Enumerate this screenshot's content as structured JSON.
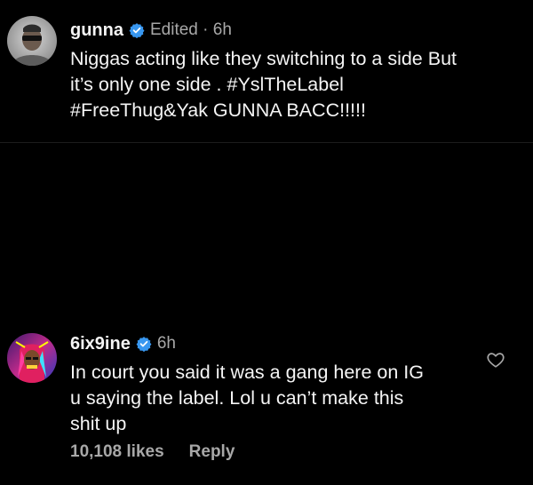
{
  "post": {
    "username": "gunna",
    "meta": "Edited · 6h",
    "lines": [
      "Niggas acting like they switching to a side But",
      "it’s only one side . #YslTheLabel",
      "#FreeThug&Yak  GUNNA BACC!!!!!"
    ],
    "avatar_icon": "avatar-icon"
  },
  "comment": {
    "username": "6ix9ine",
    "meta": "6h",
    "lines": [
      "In court you said it was a gang here on IG",
      "u saying the label. Lol u can’t make this",
      "shit up"
    ],
    "likes": "10,108 likes",
    "reply_label": "Reply",
    "avatar_icon": "avatar-icon",
    "like_icon": "heart-outline-icon"
  },
  "icons": {
    "verified": "verified-badge-icon"
  },
  "colors": {
    "background": "#000000",
    "text_primary": "#f5f5f5",
    "text_secondary": "#a8a8a8",
    "verified_blue": "#3897f0"
  }
}
